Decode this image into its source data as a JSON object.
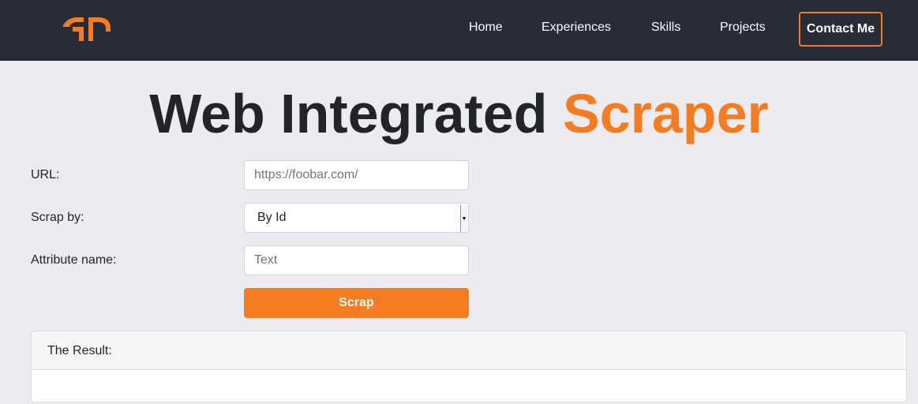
{
  "navbar": {
    "logo_icon": "gp-logo-icon",
    "links": [
      "Home",
      "Experiences",
      "Skills",
      "Projects"
    ],
    "contact_label": "Contact Me",
    "accent_color": "#f57c20",
    "background_color": "#272c37"
  },
  "title": {
    "main": "Web Integrated ",
    "accent": "Scraper"
  },
  "form": {
    "url_label": "URL:",
    "url_placeholder": "https://foobar.com/",
    "scrap_by_label": "Scrap by:",
    "scrap_by_selected": "By Id",
    "attribute_label": "Attribute name:",
    "attribute_placeholder": "Text",
    "submit_label": "Scrap"
  },
  "result": {
    "header": "The Result:"
  }
}
